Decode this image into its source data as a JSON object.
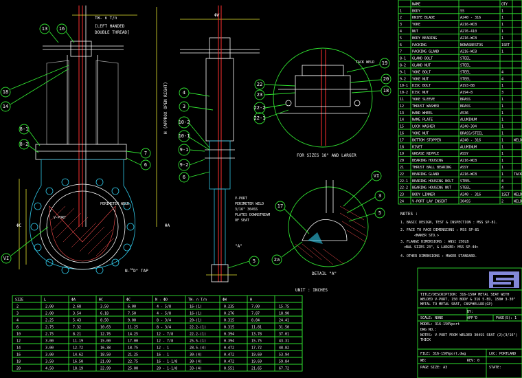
{
  "colors": {
    "background": "#000000",
    "outline": "#31e331",
    "text": "#ffffff",
    "dimension": "#e8e830",
    "stem": "#ff3030",
    "body": "#30c8e8"
  },
  "front_view": {
    "stem_note": "TW- n T/n",
    "thread_note_1": "[LEFT HANDED",
    "thread_note_2": "DOUBLE THREAD]",
    "height_label": "H (APPROX OPEN RIGHT)",
    "perimeter_weld": "PERIMETER WELD",
    "v_port": "V-PORT",
    "tap_label": "N-",
    "tap_sup": "no",
    "tap_tail": "D\" TAP",
    "dim_oc": "ΦC",
    "dim_oa": "ΦA",
    "callouts": [
      "13",
      "16",
      "18",
      "14",
      "8-1",
      "8-2",
      "7",
      "6",
      "VI"
    ]
  },
  "side_view": {
    "top_dim": "ΦW",
    "weld_note": [
      "V-PORT",
      "PERIMETER WELD",
      "3/16\" 304SS",
      "PLATES DOWNSTREAM",
      "OF SEAT"
    ],
    "detail_ref": "\"A\"",
    "callouts": [
      "4",
      "3",
      "10-2",
      "10-1",
      "9-1",
      "9-2",
      "6",
      "5"
    ]
  },
  "detail_top": {
    "caption": "FOR SIZES 18\" AND LARGER",
    "tack_weld": "TACK WELD",
    "callouts": [
      "22",
      "23",
      "22-2",
      "22-1",
      "19",
      "20",
      "18"
    ]
  },
  "detail_a": {
    "caption": "DETAIL \"A\"",
    "callouts": [
      "17",
      "2a",
      "VI",
      "3",
      "5"
    ]
  },
  "bom": {
    "header": [
      "",
      "NAME",
      "",
      "QTY",
      ""
    ],
    "rows": [
      [
        "1",
        "BODY",
        "SS",
        "1",
        ""
      ],
      [
        "2",
        "KNIFE BLADE",
        "A240 - 316",
        "1",
        ""
      ],
      [
        "3",
        "YOKE",
        "A216-WCB",
        "1",
        ""
      ],
      [
        "4",
        "NUT",
        "A276-410",
        "1",
        ""
      ],
      [
        "5",
        "BODY BEARING",
        "A216-WCB",
        "1",
        ""
      ],
      [
        "6",
        "PACKING",
        "NONASBESTOS",
        "1SET",
        ""
      ],
      [
        "7",
        "PACKING GLAND",
        "A216-WCB",
        "1",
        ""
      ],
      [
        "8-1",
        "GLAND BOLT",
        "STEEL",
        "",
        ""
      ],
      [
        "8-2",
        "GLAND NUT",
        "STEEL",
        "",
        ""
      ],
      [
        "9-1",
        "YOKE BOLT",
        "STEEL",
        "4",
        ""
      ],
      [
        "9-2",
        "YOKE NUT",
        "STEEL",
        "4",
        ""
      ],
      [
        "10-1",
        "DISC BOLT",
        "A193-B8",
        "1",
        ""
      ],
      [
        "10-2",
        "DISC NUT",
        "A194-8",
        "3",
        ""
      ],
      [
        "11",
        "YOKE SLEEVE",
        "BRASS",
        "1",
        ""
      ],
      [
        "12",
        "THRUST WASHER",
        "BRASS",
        "1",
        ""
      ],
      [
        "13",
        "HAND WHEEL",
        "A536",
        "1",
        ""
      ],
      [
        "14",
        "NAME PLATE",
        "ALUMINUM",
        "1",
        ""
      ],
      [
        "15",
        "LOCK WASHER",
        "A240-304",
        "1",
        ""
      ],
      [
        "16",
        "YOKE NUT",
        "BRASS/STEEL",
        "1",
        ""
      ],
      [
        "17",
        "BOTTOM STOPPER",
        "A240 - 316",
        "1",
        "WELD"
      ],
      [
        "18",
        "RIVET",
        "ALUMINUM",
        "1",
        ""
      ],
      [
        "19",
        "GREASE NIPPLE",
        "ASSY",
        "1",
        ""
      ],
      [
        "20",
        "BEARING HOUSING",
        "A216-WCB",
        "1",
        ""
      ],
      [
        "21",
        "THRUST BALL BEARING",
        "ASSY",
        "1",
        ""
      ],
      [
        "22",
        "BEARING GLAND",
        "A216-WCB",
        "1",
        "TACK"
      ],
      [
        "22-1",
        "BEARING HOUSING BOLT",
        "STEEL",
        "4",
        ""
      ],
      [
        "22-2",
        "BEARING HOUSING NUT",
        "STEEL",
        "4",
        ""
      ],
      [
        "23",
        "BODY LINNER",
        "A240 - 316",
        "1SET",
        "WELD"
      ],
      [
        "24",
        "V-PORT LAY INSERT",
        "304SS",
        "2",
        "WELD"
      ]
    ]
  },
  "notes": {
    "title": "NOTES :",
    "lines": [
      "1. BASIC DESIGN, TEST & INSPECTION : MSS SP-81.",
      "2. FACE TO FACE DIMENSIONS : MSS SP-81",
      "<MAKER STD.>",
      "3. FLANGE DIMENSIONS : ANSI 150LB",
      "<BAL SIZES 23\", & LARGER: MSS SP-44>",
      "4. OTHER DIMENSIONS : MAKER STANDARD."
    ]
  },
  "dim_table": {
    "unit": "UNIT : INCHES",
    "headers": [
      "SIZE",
      "L",
      "ΦA",
      "ΦC",
      "ΦC",
      "N - ΦD",
      "TW- n T/n",
      "ΦW",
      "H"
    ],
    "rows": [
      [
        "2",
        "2.00",
        "2.68",
        "3.50",
        "6.00",
        "4 - 5/8",
        "16-(1)",
        "0.235",
        "7.00",
        "15.75"
      ],
      [
        "3",
        "2.00",
        "3.54",
        "6.18",
        "7.50",
        "4 - 5/8",
        "16-(1)",
        "0.276",
        "7.87",
        "18.90"
      ],
      [
        "4",
        "2.25",
        "5.43",
        "8.50",
        "9.00",
        "8 - 3/4",
        "20-(1)",
        "0.315",
        "8.84",
        "24.41"
      ],
      [
        "6",
        "2.75",
        "7.32",
        "10.63",
        "11.25",
        "8 - 3/4",
        "22.2-(1)",
        "0.315",
        "11.81",
        "31.50"
      ],
      [
        "10",
        "2.75",
        "8.21",
        "12.76",
        "14.25",
        "12 - 7/8",
        "22.2-(1)",
        "0.394",
        "13.78",
        "37.01"
      ],
      [
        "12",
        "3.00",
        "11.19",
        "15.00",
        "17.00",
        "12 - 7/8",
        "25.5-(1)",
        "0.394",
        "15.75",
        "43.31"
      ],
      [
        "14",
        "3.00",
        "12.72",
        "16.38",
        "18.75",
        "12 - 1",
        "28.5-(4)",
        "0.472",
        "17.72",
        "48.82"
      ],
      [
        "16",
        "3.00",
        "14.62",
        "18.50",
        "21.25",
        "16 - 1",
        "30-(4)",
        "0.472",
        "19.69",
        "53.94"
      ],
      [
        "18",
        "3.50",
        "16.50",
        "21.00",
        "22.75",
        "16 - 1-1/8",
        "30-(4)",
        "0.472",
        "19.69",
        "59.84"
      ],
      [
        "20",
        "4.50",
        "18.19",
        "22.99",
        "25.00",
        "20 - 1-1/8",
        "33-(4)",
        "0.551",
        "21.65",
        "67.72"
      ]
    ]
  },
  "title_block": {
    "desc_1": "TITLE/DESCRIPTION: 316-150# METAL SEAT WITH",
    "desc_2": "WELDED V-PORT, 150 BODY & 316 5-ED, 150# 3-30\"",
    "desc_3": "METAL TO METAL SEAT, C8SFHELLDD(GP)",
    "by": "BY:",
    "scale": "SCALE: NONE",
    "appd": "APP'D",
    "page": "PAGE(S): 1",
    "model": "MODEL: 316-150Vport",
    "dwg": "DWG NO.:",
    "notes_line_1": "NOTES: V-PORT FROM WELDED 304SS SEAT (2)(3/16\")",
    "notes_line_2": "THICK",
    "file": "FILE: 316-150Vport.dwg",
    "loc": "LOC: PORTLAND",
    "wb": "WB:",
    "rev": "REV: 0",
    "page_size": "PAGE SIZE: A3",
    "state": "STATE:"
  }
}
